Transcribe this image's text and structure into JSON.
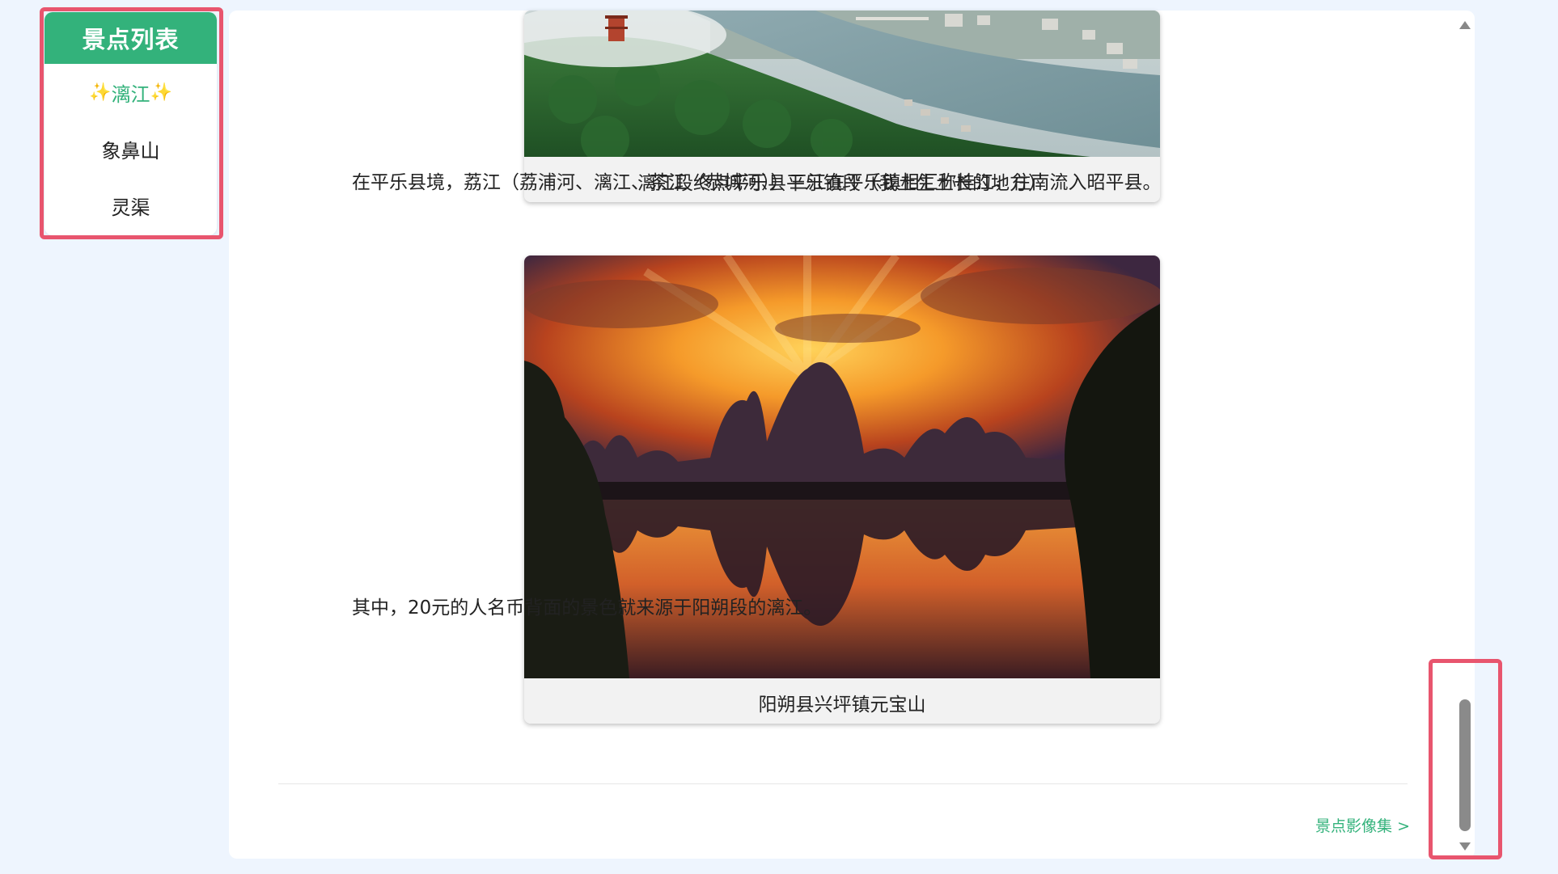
{
  "sidebar": {
    "title": "景点列表",
    "items": [
      {
        "label": "漓江",
        "prefix": "✨",
        "suffix": "✨",
        "active": true
      },
      {
        "label": "象鼻山",
        "active": false
      },
      {
        "label": "灵渠",
        "active": false
      }
    ]
  },
  "content": {
    "figures": [
      {
        "caption": "漓江段终点平乐县平乐镇段（我土生土长的地方）",
        "image": "aerial view of Lijiang river town with green hills"
      },
      {
        "caption": "阳朔县兴坪镇元宝山",
        "image": "sunset over karst mountains reflected in river"
      }
    ],
    "paragraphs": [
      "在平乐县境，荔江（荔浦河、漓江、茶江（恭城河））三江在平乐镇相汇称桂江，往南流入昭平县。",
      "其中，20元的人名币背面的景色就来源于阳朔段的漓江。"
    ],
    "gallery_link": "景点影像集 >"
  },
  "colors": {
    "accent": "#33b27b",
    "highlight": "#e8556e",
    "background": "#eef5fe"
  }
}
